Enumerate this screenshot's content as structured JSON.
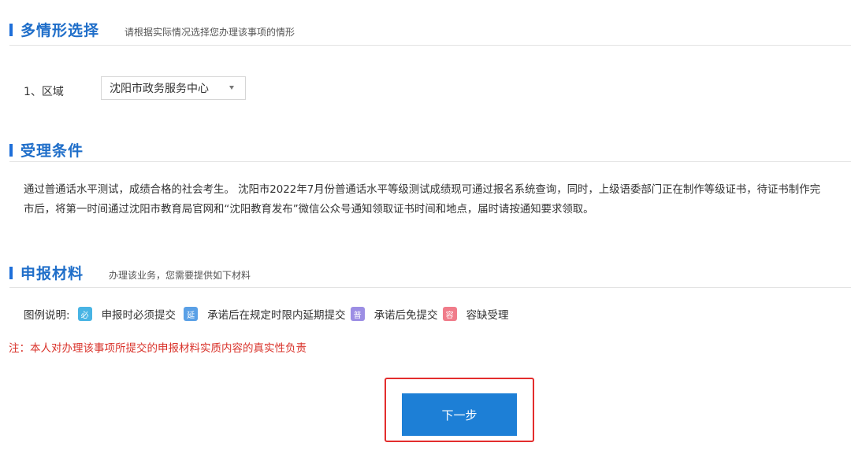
{
  "scenario": {
    "title": "多情形选择",
    "subtitle": "请根据实际情况选择您办理该事项的情形",
    "field_label": "1、区域",
    "region_value": "沈阳市政务服务中心"
  },
  "conditions": {
    "title": "受理条件",
    "line1": "通过普通话水平测试，成绩合格的社会考生。 沈阳市2022年7月份普通话水平等级测试成绩现可通过报名系统查询，同时，上级语委部门正在制作等级证书，待证书制作完",
    "line2": "市后，将第一时间通过沈阳市教育局官网和“沈阳教育发布”微信公众号通知领取证书时间和地点，届时请按通知要求领取。"
  },
  "materials": {
    "title": "申报材料",
    "subtitle": "办理该业务，您需要提供如下材料",
    "legend_label": "图例说明:",
    "legend": [
      {
        "badge": "必",
        "text": "申报时必须提交",
        "color": "#48b4e4"
      },
      {
        "badge": "延",
        "text": "承诺后在规定时限内延期提交",
        "color": "#5aa0e6"
      },
      {
        "badge": "普",
        "text": "承诺后免提交",
        "color": "#9c8ee4"
      },
      {
        "badge": "容",
        "text": "容缺受理",
        "color": "#f07c8a"
      }
    ],
    "note": "注：本人对办理该事项所提交的申报材料实质内容的真实性负责"
  },
  "actions": {
    "next_label": "下一步"
  }
}
